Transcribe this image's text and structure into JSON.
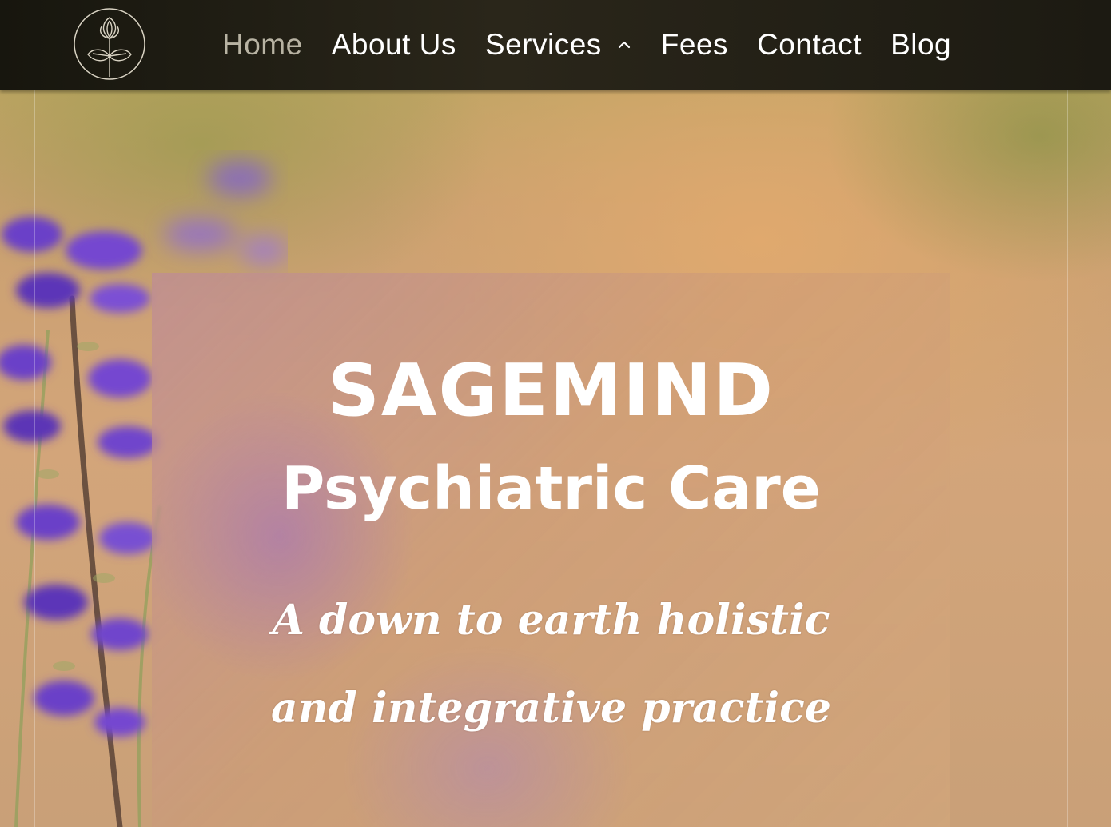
{
  "nav": {
    "logo_name": "lotus-logo",
    "items": [
      {
        "label": "Home",
        "active": true
      },
      {
        "label": "About Us",
        "active": false
      },
      {
        "label": "Services",
        "active": false,
        "has_dropdown": true,
        "dropdown_icon": "chevron-up-icon"
      },
      {
        "label": "Fees",
        "active": false
      },
      {
        "label": "Contact",
        "active": false
      },
      {
        "label": "Blog",
        "active": false
      }
    ]
  },
  "hero": {
    "title": "SAGEMIND",
    "subtitle": "Psychiatric Care",
    "tagline": "A down to earth holistic and integrative practice"
  },
  "colors": {
    "nav_background": "#1f1c13",
    "nav_text": "#ffffff",
    "nav_active_text": "#b8b3a3",
    "hero_text": "#ffffff",
    "flower_purple": "#7a4fd1"
  }
}
